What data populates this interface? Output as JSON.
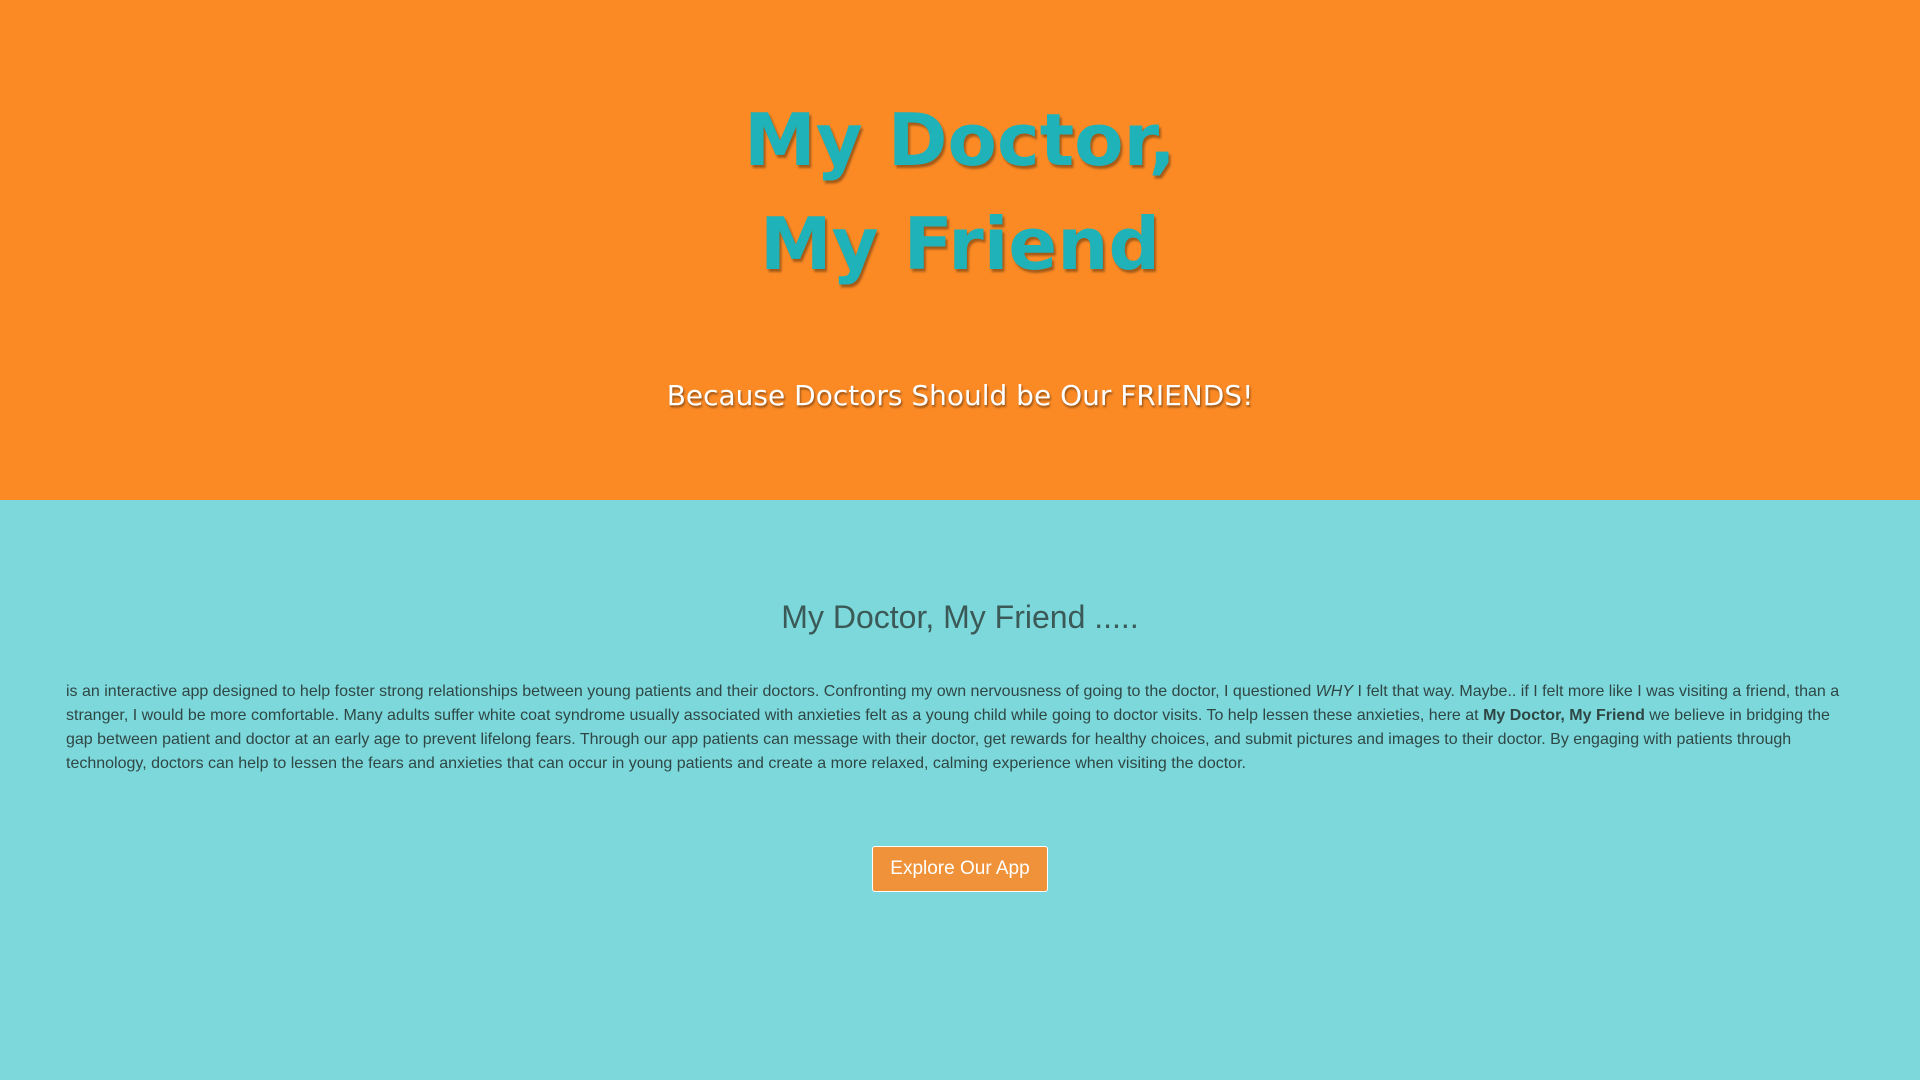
{
  "hero": {
    "title_line1": "My Doctor,",
    "title_line2": "My Friend",
    "tagline": "Because Doctors Should be Our FRIENDS!",
    "background_color": "#fb8a25",
    "title_color": "#1fb2b9"
  },
  "about": {
    "heading": "My Doctor, My Friend .....",
    "body_part1": "is an interactive app designed to help foster strong relationships between young patients and their doctors. Confronting my own nervousness of going to the doctor, I questioned ",
    "body_emphasis": "WHY",
    "body_part2": " I felt that way. Maybe.. if I felt more like I was visiting a friend, than a stranger, I would be more comfortable. Many adults suffer white coat syndrome usually associated with anxieties felt as a young child while going to doctor visits. To help lessen these anxieties, here at ",
    "body_strong": "My Doctor, My Friend",
    "body_part3": " we believe in bridging the gap between patient and doctor at an early age to prevent lifelong fears. Through our app patients can message with their doctor, get rewards for healthy choices, and submit pictures and images to their doctor. By engaging with patients through technology, doctors can help to lessen the fears and anxieties that can occur in young patients and create a more relaxed, calming experience when visiting the doctor.",
    "background_color": "#7dd8dc",
    "cta_label": "Explore Our App",
    "cta_color": "#f0923a"
  }
}
